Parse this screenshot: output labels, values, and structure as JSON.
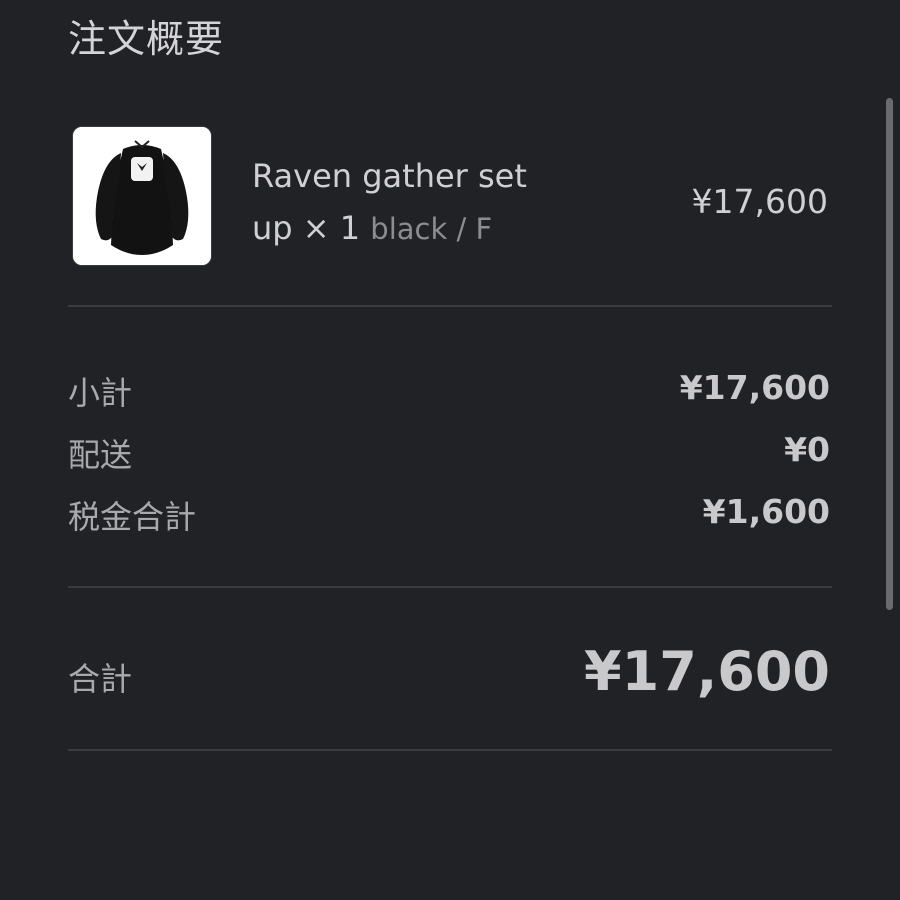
{
  "order_summary": {
    "title": "注文概要",
    "item": {
      "image_icon": "dress-thumbnail",
      "name_line1": "Raven gather set",
      "name_line2": "up",
      "quantity": "× 1",
      "variant": "black / F",
      "price": "¥17,600"
    },
    "rows": [
      {
        "label": "小計",
        "value": "¥17,600"
      },
      {
        "label": "配送",
        "value": "¥0"
      },
      {
        "label": "税金合計",
        "value": "¥1,600"
      }
    ],
    "total": {
      "label": "合計",
      "value": "¥17,600"
    }
  },
  "colors": {
    "background": "#212226",
    "text": "#c9c9cc",
    "muted": "#8c8d92",
    "divider": "#3a3b40"
  }
}
